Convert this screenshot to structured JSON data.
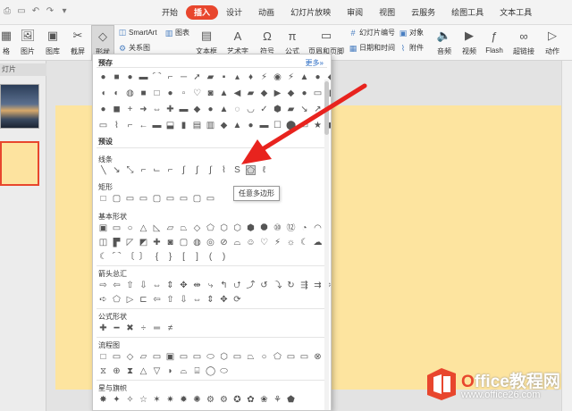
{
  "tabs": [
    "开始",
    "插入",
    "设计",
    "动画",
    "幻灯片放映",
    "审阅",
    "视图",
    "云服务",
    "绘图工具",
    "文本工具"
  ],
  "active_tab": "插入",
  "ribbon": {
    "shape_button": "形状",
    "smartart": "SmartArt",
    "chart": "图表",
    "relation": "关系图",
    "picture": "图片",
    "gallery": "图库",
    "screenshot": "截屏",
    "textbox": "文本框",
    "wordart": "艺术字",
    "symbol": "符号",
    "formula": "公式",
    "header_footer": "页眉和页脚",
    "slide_number": "幻灯片编号",
    "datetime": "日期和时间",
    "object": "对象",
    "attachment": "附件",
    "audio": "音频",
    "video": "视频",
    "flash": "Flash",
    "hyperlink": "超链接",
    "action": "动作",
    "left_cut": "格",
    "pic_label": "图片"
  },
  "left_pane": {
    "title": "灯片"
  },
  "dropdown": {
    "recent": "预存",
    "more": "更多",
    "preset": "预设",
    "lines": "线条",
    "rect": "矩形",
    "basic": "基本形状",
    "arrows": "箭头总汇",
    "formula_shapes": "公式形状",
    "flowchart": "流程图",
    "stars": "星与旗帜"
  },
  "tooltip": "任意多边形",
  "watermark": {
    "brand_o": "O",
    "brand_rest": "ffice教程网",
    "url": "www.office26.com"
  },
  "colors": {
    "accent": "#e8462d",
    "slide": "#fde49f"
  }
}
